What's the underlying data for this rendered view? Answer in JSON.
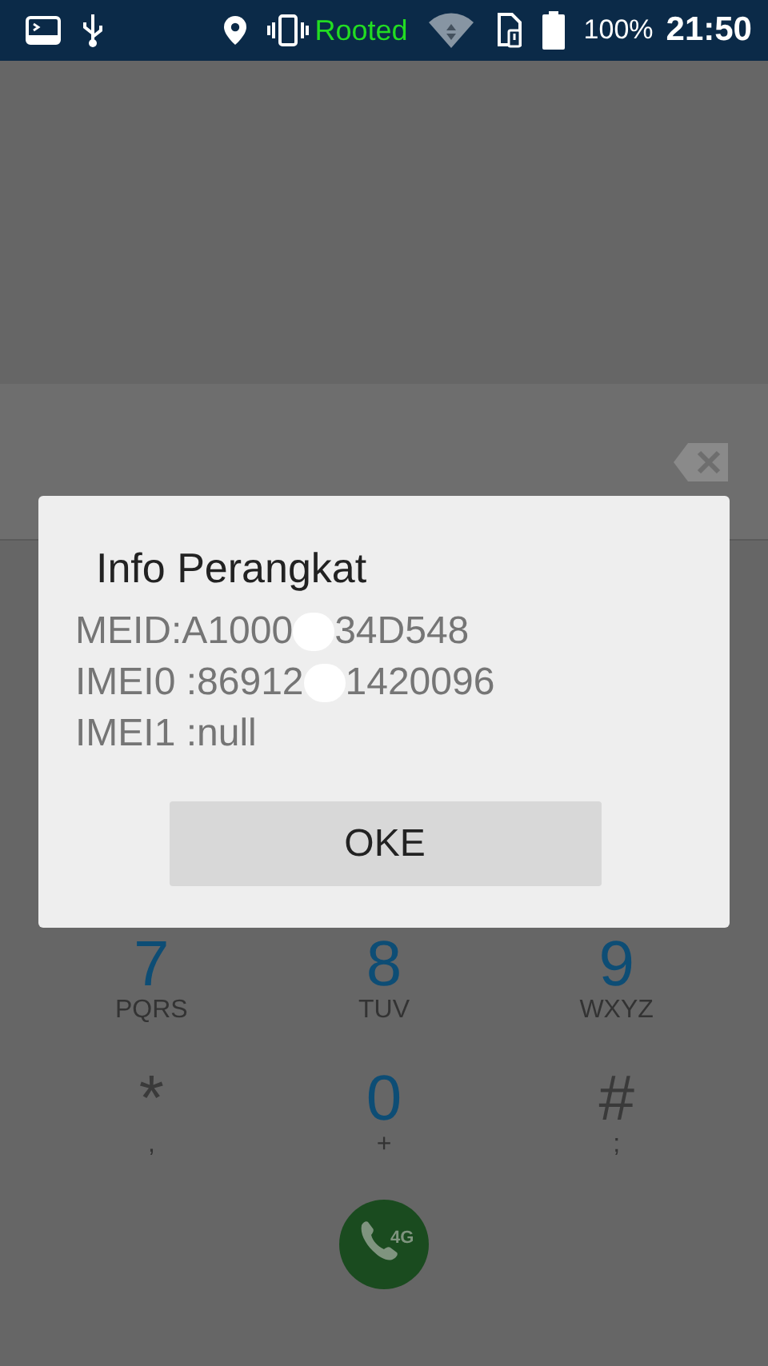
{
  "status_bar": {
    "root_label": "Rooted",
    "battery": "100%",
    "time": "21:50"
  },
  "dialog": {
    "title": "Info Perangkat",
    "lines": [
      {
        "parts": [
          "MEID:A1000",
          "34D548"
        ]
      },
      {
        "parts": [
          "IMEI0 :86912",
          "1420096"
        ]
      },
      {
        "parts": [
          "IMEI1 :null"
        ]
      }
    ],
    "button": "OKE"
  },
  "keypad": [
    {
      "kind": "digit",
      "digit": "7",
      "letters": "PQRS"
    },
    {
      "kind": "digit",
      "digit": "8",
      "letters": "TUV"
    },
    {
      "kind": "digit",
      "digit": "9",
      "letters": "WXYZ"
    },
    {
      "kind": "symbol",
      "digit": "*",
      "letters": ","
    },
    {
      "kind": "digit",
      "digit": "0",
      "letters": "+"
    },
    {
      "kind": "symbol",
      "digit": "#",
      "letters": ";"
    }
  ],
  "call_button": {
    "badge": "4G"
  }
}
